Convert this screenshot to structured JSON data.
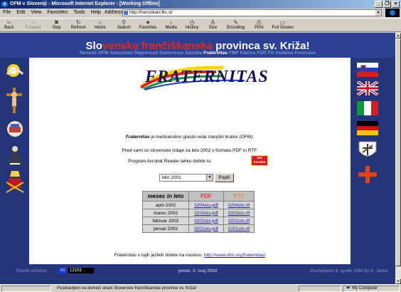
{
  "window": {
    "title": "OFM v Sloveniji - Microsoft Internet Explorer - [Working Offline]",
    "buttons": [
      "_",
      "❐",
      "×"
    ]
  },
  "menu": [
    "File",
    "Edit",
    "View",
    "Favorites",
    "Tools",
    "Help"
  ],
  "address": {
    "label": "Address",
    "url": "http://franciskani.fkc.si/"
  },
  "toolbar": [
    {
      "label": "Back",
      "icon": "⇦",
      "name": "back"
    },
    {
      "label": "Forward",
      "icon": "⇨",
      "name": "forward",
      "disabled": true
    },
    {
      "label": "Stop",
      "icon": "✖",
      "name": "stop"
    },
    {
      "label": "Refresh",
      "icon": "↻",
      "name": "refresh"
    },
    {
      "label": "Home",
      "icon": "⌂",
      "name": "home"
    },
    {
      "label": "Search",
      "icon": "⚲",
      "name": "search"
    },
    {
      "label": "Favorites",
      "icon": "★",
      "name": "favorites"
    },
    {
      "label": "Media",
      "icon": "♪",
      "name": "media"
    },
    {
      "label": "History",
      "icon": "◷",
      "name": "history"
    },
    {
      "label": "Size",
      "icon": "A",
      "name": "size"
    },
    {
      "label": "Encoding",
      "icon": "✎",
      "name": "encoding"
    },
    {
      "label": "Print",
      "icon": "⎙",
      "name": "print"
    },
    {
      "label": "Full Screen",
      "icon": "▭",
      "name": "full-screen"
    }
  ],
  "header": {
    "title_part1": "Slo",
    "title_part2": "venska",
    "title_part3": " frančiškanska",
    "title_part4": " provinca sv. Križa!",
    "nav": [
      "Novosti",
      "OFM",
      "Samostani",
      "Dejavnosti",
      "Duhovnost",
      "Založba",
      "Fraternitas",
      "FMP",
      "Klarise",
      "FSR",
      "FO",
      "Vsebina",
      "Povezave"
    ],
    "active_nav": "Fraternitas"
  },
  "logo": {
    "text": "FRATERNITAS"
  },
  "content": {
    "intro_bold": "Fraternitas",
    "intro_rest": " je mednarodno glasilo reda manjših bratov (OFM).",
    "line2": "Pred vami so slovenske izdaje za leto 2002 v formatu PDF in RTF.",
    "acrobat_text": "Program Acrobat Reader lahko dobite tu:",
    "acrobat_button": "Get Acrobat Reader",
    "select_value": "leto 2001",
    "go_button": "Pojdi!",
    "table": {
      "headers": [
        "mesec in leto",
        "PDF",
        "RTF"
      ],
      "rows": [
        [
          "april 2002",
          "0204slo.pdf",
          "0204slo.rtf"
        ],
        [
          "marec 2002",
          "0203slo.pdf",
          "0203slo.rtf"
        ],
        [
          "februar 2002",
          "0202slo.pdf",
          "0202slo.rtf"
        ],
        [
          "januar 2002",
          "0201slo.pdf",
          "0201slo.rtf"
        ]
      ]
    },
    "footer_text": "Fraternitas v tujih jezikih dobite na naslovu: ",
    "footer_link": "http://www.ofm.org/fraternitas/"
  },
  "bottom": {
    "counter_label": "Število obiskov:",
    "counter_badge": "FC",
    "counter_value": "12153",
    "date": "petek, 3. maj 2002",
    "updated_text": "Postavljeno 8. aprila 1999 by ",
    "updated_link": "fr. Janez"
  },
  "status": {
    "message": "Pozdravljeni na domači strani Slovenske frančiškanske province sv. Križa!",
    "zone": "My Computer"
  },
  "colors": {
    "page_bg": "#25357a",
    "title_red": "#e02a20",
    "pdf_red": "#ff0000",
    "rtf_orange": "#e8861c"
  }
}
